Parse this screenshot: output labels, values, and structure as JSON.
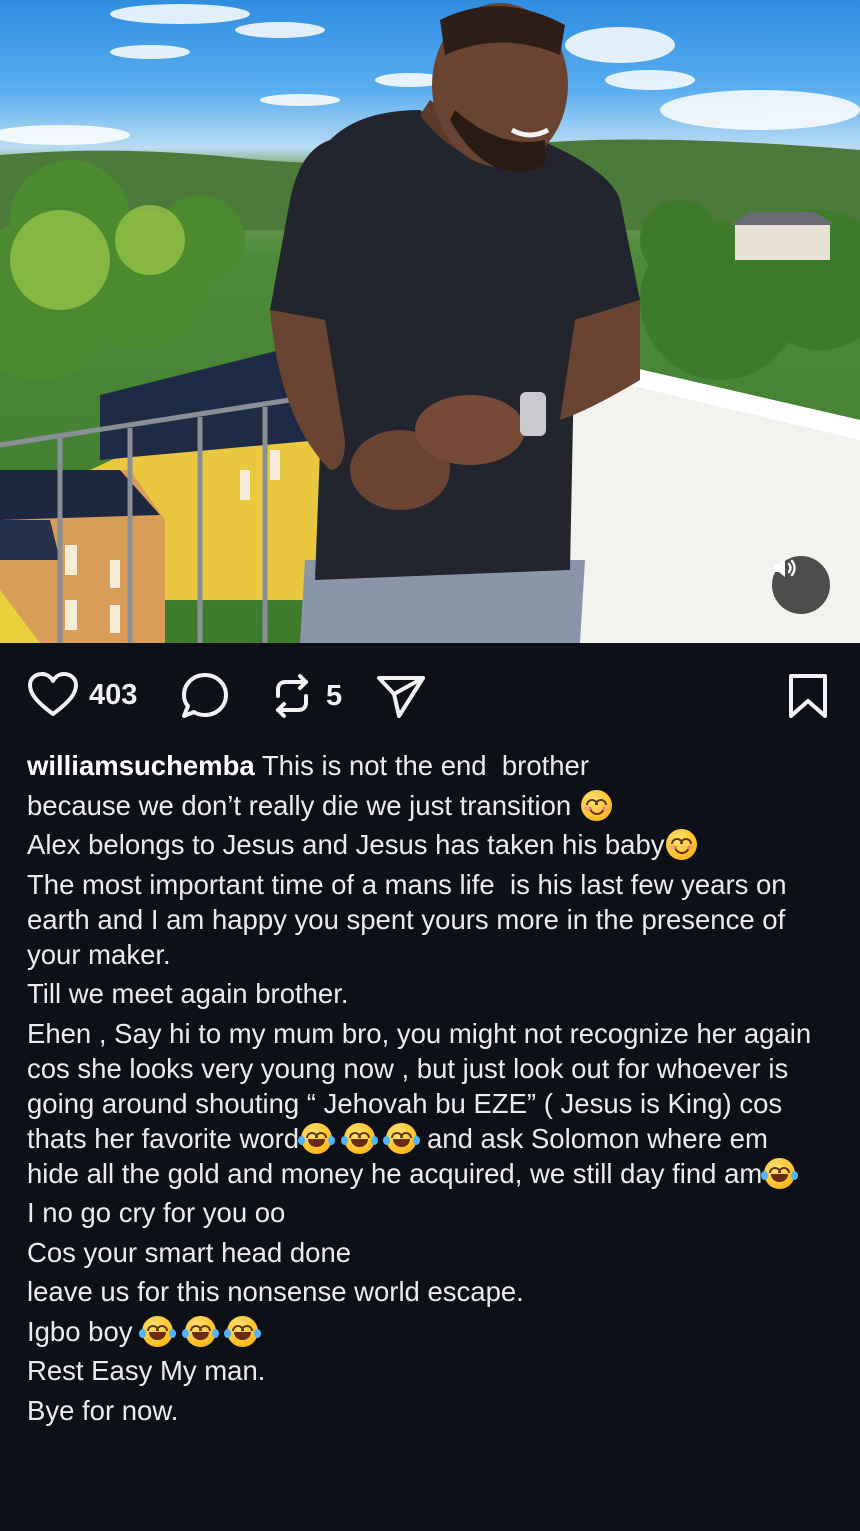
{
  "post": {
    "username": "williamsuchemba",
    "likes": "403",
    "reposts": "5"
  },
  "icons": {
    "like": "heart-icon",
    "comment": "comment-bubble-icon",
    "repost": "repost-icon",
    "share": "send-icon",
    "save": "bookmark-icon",
    "audio": "speaker-icon"
  },
  "caption": {
    "line1": " This is not the end  brother",
    "line2": "because we don’t really die we just transition ",
    "line3": "Alex belongs to Jesus and Jesus has taken his baby",
    "line4": "The most important time of a mans life  is his last few years on earth and I am happy you spent yours more in the presence of your maker.",
    "line5": "Till we meet again brother.",
    "line6a": "Ehen , Say hi to my mum bro, you might not recognize her again cos she looks very young now , but just look out for whoever is going around shouting “ Jehovah bu EZE” ( Jesus is King) cos thats her favorite word",
    "line6b": " and ask Solomon where em hide all the gold and money he acquired, we still day find am",
    "line7": "I no go cry for you oo",
    "line8": "Cos your smart head done",
    "line9": "leave us for this nonsense world escape.",
    "line10": "Igbo boy ",
    "line11": "Rest Easy My man.",
    "line12": "Bye for now."
  },
  "colors": {
    "background": "#0d1117",
    "text": "#f2f2f2"
  }
}
